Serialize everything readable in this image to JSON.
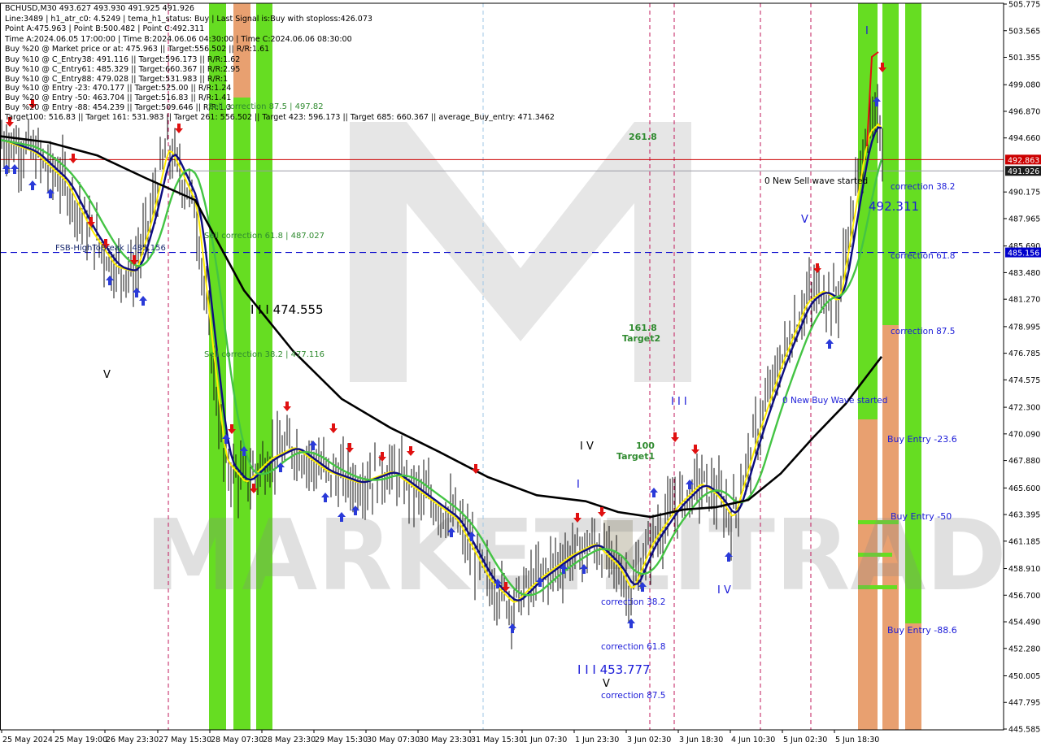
{
  "header": {
    "symbol_line": "BCHUSD,M30  493.627 493.930 491.925 491.926",
    "info_lines": [
      "Line:3489 | h1_atr_c0: 4.5249 | tema_h1_status: Buy | Last Signal is:Buy with stoploss:426.073",
      "Point A:475.963 | Point B:500.482 | Point C:492.311",
      "Time A:2024.06.05 17:00:00 | Time B:2024.06.06 04:30:00 | Time C:2024.06.06 08:30:00",
      "Buy %20 @ Market price or at: 475.963 || Target:556.502 || R/R:1.61",
      "Buy %10 @ C_Entry38: 491.116 || Target:596.173 || R/R:1.62",
      "Buy %10 @ C_Entry61: 485.329 || Target:660.367 || R/R:2.95",
      "Buy %10 @ C_Entry88: 479.028 || Target:531.983 || R/R:1",
      "Buy %10 @ Entry -23: 470.177 || Target:525.00 || R/R:1.24",
      "Buy %20 @ Entry -50: 463.704 || Target:516.83 || R/R:1.41",
      "Buy %20 @ Entry -88: 454.239 || Target:509.646 || R/R:1.3",
      "Target100: 516.83 || Target 161: 531.983 || Target 261: 556.502 || Target 423: 596.173 || Target 685: 660.367 || average_Buy_entry: 471.3462"
    ]
  },
  "price_axis": {
    "labels": [
      "505.775",
      "503.565",
      "501.355",
      "499.080",
      "496.870",
      "494.660",
      "492.863",
      "491.926",
      "490.175",
      "487.965",
      "485.690",
      "485.156",
      "483.480",
      "481.270",
      "478.995",
      "476.785",
      "474.575",
      "472.300",
      "470.090",
      "467.880",
      "465.600",
      "463.395",
      "461.185",
      "458.910",
      "456.700",
      "454.490",
      "452.280",
      "450.005",
      "447.795",
      "445.585"
    ],
    "current_price": "491.926",
    "red_level": "492.863",
    "blue_level": "485.156"
  },
  "time_axis": [
    "25 May 2024",
    "25 May 19:00",
    "26 May 23:30",
    "27 May 15:30",
    "28 May 07:30",
    "28 May 23:30",
    "29 May 15:30",
    "30 May 07:30",
    "30 May 23:30",
    "31 May 15:30",
    "1 Jun 07:30",
    "1 Jun 23:30",
    "3 Jun 02:30",
    "3 Jun 18:30",
    "4 Jun 10:30",
    "5 Jun 02:30",
    "5 Jun 18:30"
  ],
  "annotations": {
    "sell_corr_875": "Sell correction 87.5 | 497.82",
    "sell_corr_618": "Sell correction 61.8 | 487.027",
    "sell_corr_382": "Sell correction 38.2 | 477.116",
    "fsb": "FSB-HighToBreak | 485.156",
    "wave3_left": "I I I 474.555",
    "wave3_bottom": "I I I 453.777",
    "v_left": "V",
    "t2618": "261.8",
    "t1618": "161.8",
    "target2": "Target2",
    "t100": "100",
    "target1": "Target1",
    "iv_mid": "I V",
    "i_mid": "I",
    "iii_mid": "I I I",
    "iv_right": "I V",
    "v_right": "V",
    "i_top": "I",
    "v_bottom": "V",
    "bottom_corr_382": "correction 38.2",
    "bottom_corr_618": "correction 61.8",
    "bottom_corr_875": "correction 87.5",
    "sell_wave": "0 New Sell wave started",
    "buy_wave": "0 New Buy Wave started",
    "price_c": "492.311",
    "r_corr_382": "correction 38.2",
    "r_corr_618": "correction 61.8",
    "r_corr_875": "correction 87.5",
    "buy_entry_236": "Buy Entry -23.6",
    "buy_entry_50": "Buy Entry -50",
    "buy_entry_886": "Buy Entry -88.6"
  },
  "watermark": "MARKETZITRADE",
  "colors": {
    "green_zone": "#66dd22",
    "orange_zone": "#e8a070",
    "ma_black": "#000000",
    "ma_green": "#44c444",
    "ma_navy": "#0d0d80",
    "ma_yellow": "#ffee00",
    "red_line": "#cc0000",
    "blue_line": "#0000cc"
  },
  "chart_data": {
    "type": "line",
    "symbol": "BCHUSD",
    "timeframe": "M30",
    "ylim": [
      445.585,
      505.775
    ],
    "x": [
      "25 May 2024",
      "25 May 19:00",
      "26 May 23:30",
      "27 May 15:30",
      "28 May 07:30",
      "28 May 23:30",
      "29 May 15:30",
      "30 May 07:30",
      "30 May 23:30",
      "31 May 15:30",
      "1 Jun 07:30",
      "1 Jun 23:30",
      "3 Jun 02:30",
      "3 Jun 18:30",
      "4 Jun 10:30",
      "5 Jun 02:30",
      "5 Jun 18:30"
    ],
    "series": [
      {
        "values": [
          494.5,
          492.0,
          486.0,
          490.5,
          468.0,
          469.0,
          466.5,
          467.0,
          463.0,
          456.5,
          459.5,
          460.0,
          463.5,
          466.0,
          464.5,
          482.0,
          494.0
        ]
      }
    ],
    "levels": {
      "current": 491.926,
      "red": 492.863,
      "fsb_high_to_break": 485.156
    }
  }
}
